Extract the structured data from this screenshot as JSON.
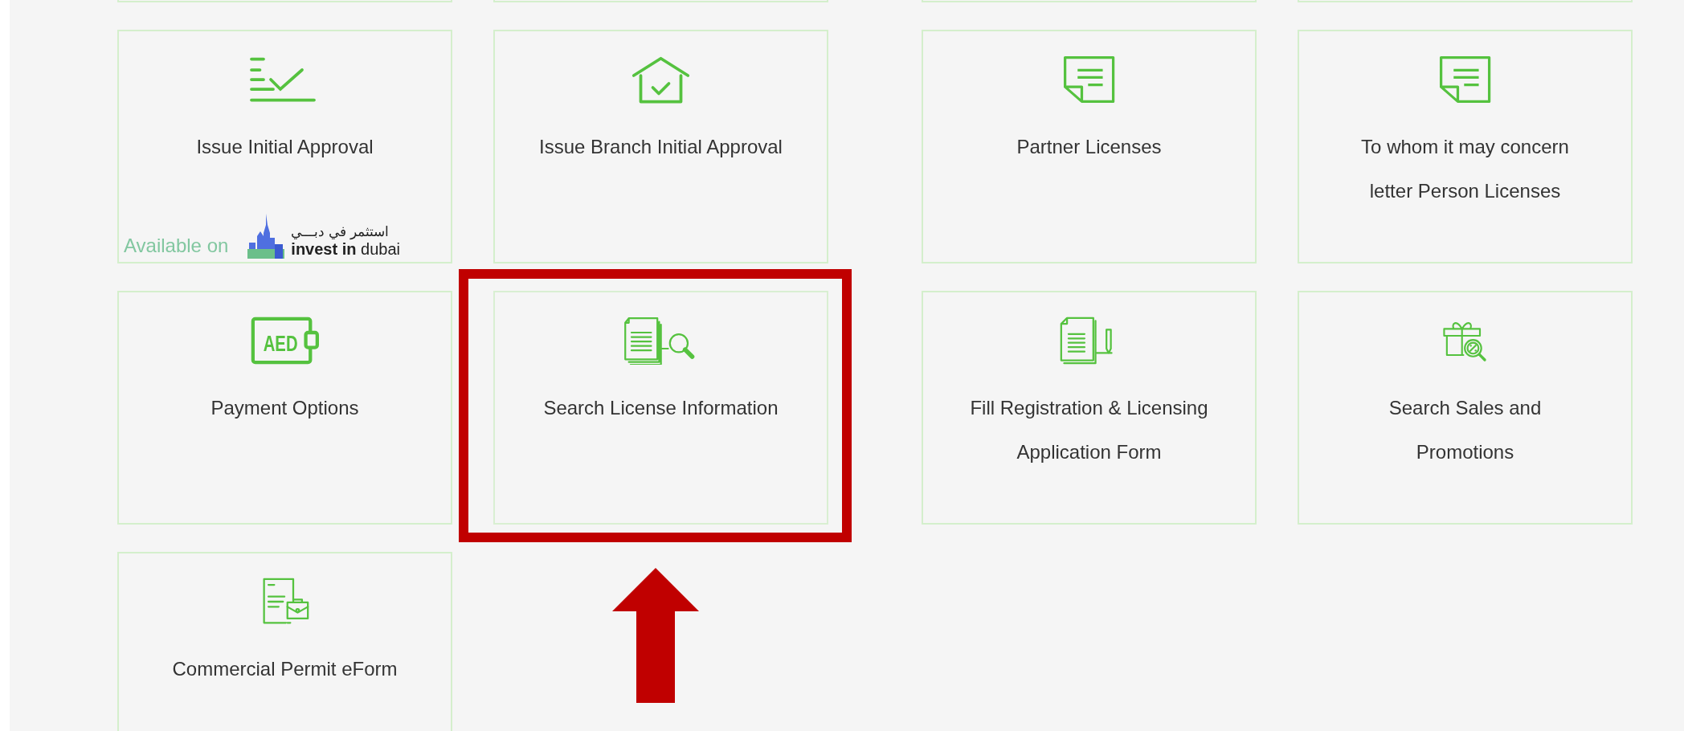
{
  "cards": [
    {
      "title": "Issue Initial Approval",
      "highlighted": false,
      "badge": {
        "label": "Available on",
        "logo_arabic": "استثمر في دبـــي",
        "logo_text": "**invest in** dubai"
      }
    },
    {
      "title": "Issue Branch Initial Approval",
      "highlighted": false
    },
    {
      "title": "Partner Licenses",
      "highlighted": false
    },
    {
      "title": "To whom it may concern letter Person Licenses",
      "highlighted": false
    },
    {
      "title": "Payment Options",
      "highlighted": false,
      "icon_text": "AED"
    },
    {
      "title": "Search License Information",
      "highlighted": true
    },
    {
      "title": "Fill Registration & Licensing Application Form",
      "highlighted": false
    },
    {
      "title": "Search Sales and Promotions",
      "highlighted": false
    },
    {
      "title": "Commercial Permit eForm",
      "highlighted": false
    }
  ]
}
